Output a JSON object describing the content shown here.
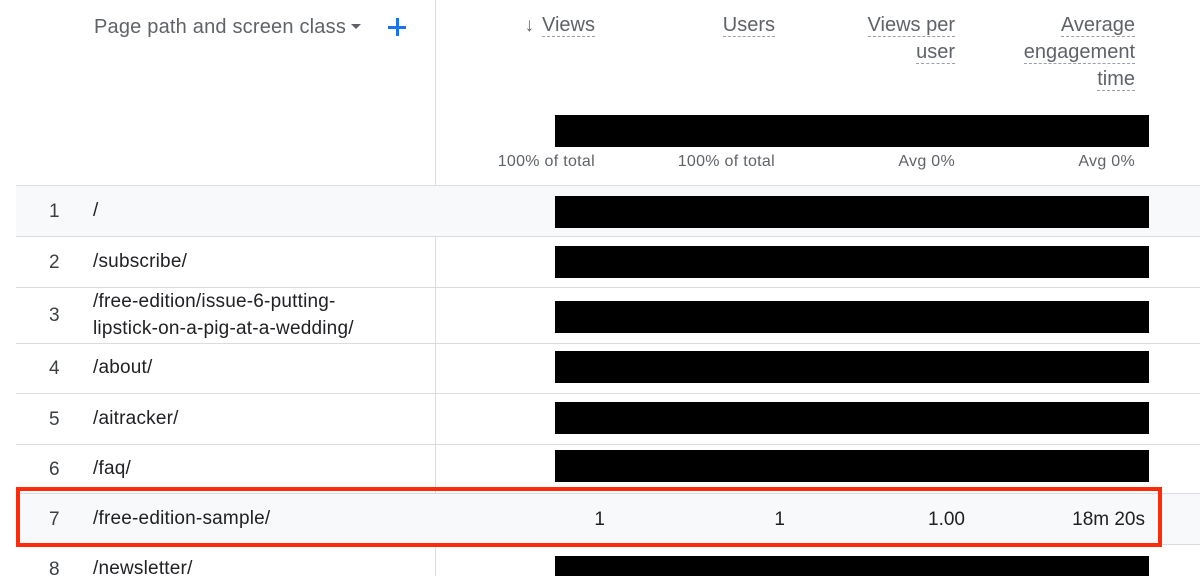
{
  "table": {
    "dimension_header": "Page path and screen class",
    "dimension_dropdown_icon": "caret-down-icon",
    "add_dimension_icon": "plus-icon",
    "columns": {
      "views": {
        "label": "Views",
        "sort_icon": "arrow-down-icon",
        "sorted": "descending"
      },
      "users": {
        "label": "Users"
      },
      "views_per_user": {
        "line1": "Views per",
        "line2": "user"
      },
      "avg_engagement": {
        "line1": "Average",
        "line2": "engagement",
        "line3": "time"
      }
    },
    "totals": {
      "views": "100% of total",
      "users": "100% of total",
      "views_per_user": "Avg 0%",
      "avg_engagement": "Avg 0%"
    },
    "rows": [
      {
        "rank": "1",
        "path": "/"
      },
      {
        "rank": "2",
        "path": "/subscribe/"
      },
      {
        "rank": "3",
        "path_line1": "/free-edition/issue-6-putting-",
        "path_line2": "lipstick-on-a-pig-at-a-wedding/"
      },
      {
        "rank": "4",
        "path": "/about/"
      },
      {
        "rank": "5",
        "path": "/aitracker/"
      },
      {
        "rank": "6",
        "path": "/faq/"
      },
      {
        "rank": "7",
        "path": "/free-edition-sample/",
        "views": "1",
        "users": "1",
        "views_per_user": "1.00",
        "avg_engagement": "18m 20s"
      },
      {
        "rank": "8",
        "path": "/newsletter/"
      }
    ]
  },
  "colors": {
    "highlight": "#ff2a0a",
    "accent": "#1a73e8",
    "redaction": "#000000"
  }
}
